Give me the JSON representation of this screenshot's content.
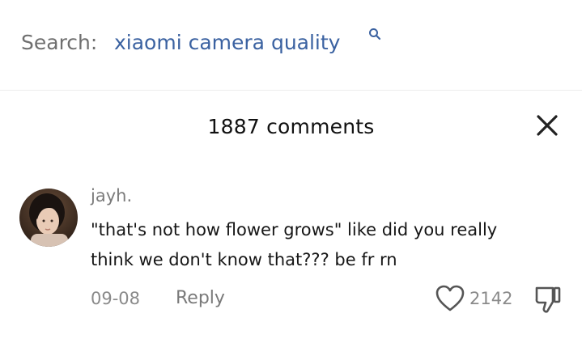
{
  "search": {
    "label": "Search:",
    "query": "xiaomi camera quality"
  },
  "comments_panel": {
    "count_label": "1887 comments"
  },
  "comment": {
    "username": "jayh.",
    "text_line1": "\"that's not how flower grows\" like did you really",
    "text_line2": "think we don't know that??? be fr rn",
    "date": "09-08",
    "reply_label": "Reply",
    "like_count": "2142"
  },
  "icons": {
    "search": "search-icon",
    "close": "close-icon",
    "like": "heart-icon",
    "dislike": "thumbs-down-icon"
  },
  "colors": {
    "query_blue": "#3b62a1",
    "muted_text": "#8a8a8a"
  }
}
